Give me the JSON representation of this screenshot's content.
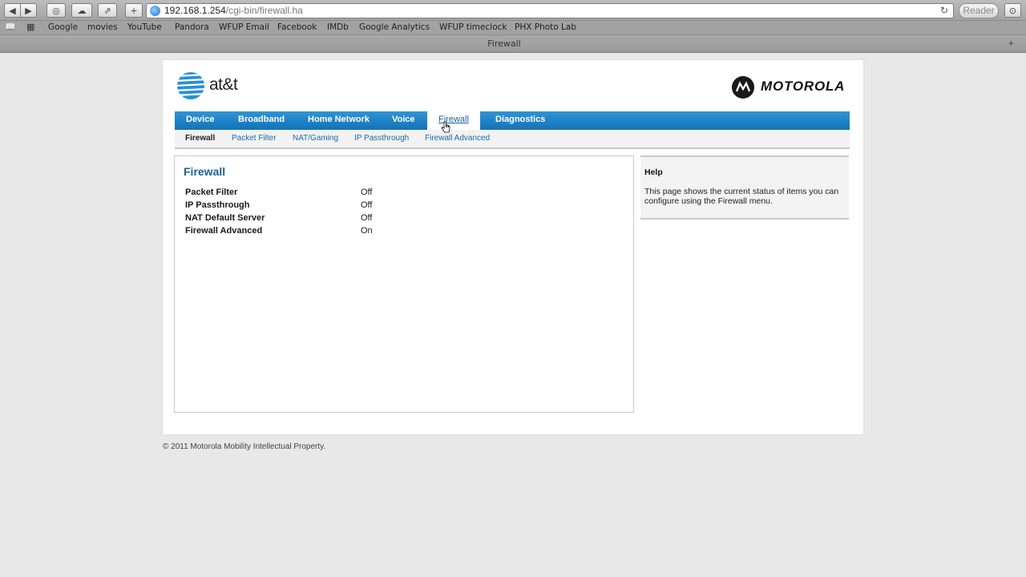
{
  "browser": {
    "url_host": "192.168.1.254",
    "url_path": "/cgi-bin/firewall.ha",
    "reader_label": "Reader",
    "tab_title": "Firewall",
    "bookmarks": [
      "Google",
      "movies",
      "YouTube",
      "Pandora",
      "WFUP Email",
      "Facebook",
      "IMDb",
      "Google Analytics",
      "WFUP timeclock",
      "PHX Photo Lab"
    ]
  },
  "brand": {
    "att": "at&t",
    "motorola": "MOTOROLA"
  },
  "main_nav": [
    "Device",
    "Broadband",
    "Home Network",
    "Voice",
    "Firewall",
    "Diagnostics"
  ],
  "sub_nav": [
    "Firewall",
    "Packet Filter",
    "NAT/Gaming",
    "IP Passthrough",
    "Firewall Advanced"
  ],
  "content": {
    "title": "Firewall",
    "rows": [
      {
        "key": "Packet Filter",
        "value": "Off"
      },
      {
        "key": "IP Passthrough",
        "value": "Off"
      },
      {
        "key": "NAT Default Server",
        "value": "Off"
      },
      {
        "key": "Firewall Advanced",
        "value": "On"
      }
    ]
  },
  "help": {
    "title": "Help",
    "text": "This page shows the current status of items you can configure using the Firewall menu."
  },
  "footer": "© 2011 Motorola Mobility Intellectual Property.",
  "colors": {
    "nav_blue": "#1472b8",
    "link_blue": "#1a6aa8",
    "title_blue": "#1a5f9e"
  }
}
